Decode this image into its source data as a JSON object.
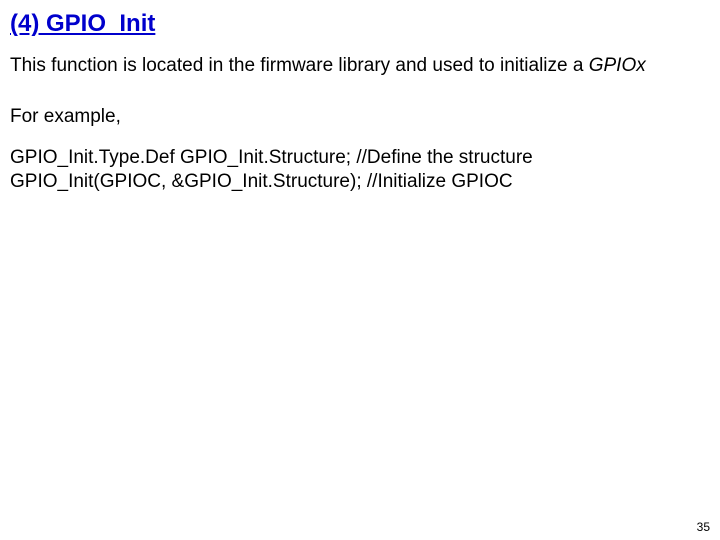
{
  "heading": "(4) GPIO_Init",
  "desc_part1": "This function is located in the firmware library and used to initialize a ",
  "desc_italic": "GPIOx",
  "example_label": "For example,",
  "code_line1": "GPIO_Init.Type.Def  GPIO_Init.Structure; //Define the structure",
  "code_line2": "GPIO_Init(GPIOC, &GPIO_Init.Structure);  //Initialize GPIOC",
  "page_number": "35"
}
